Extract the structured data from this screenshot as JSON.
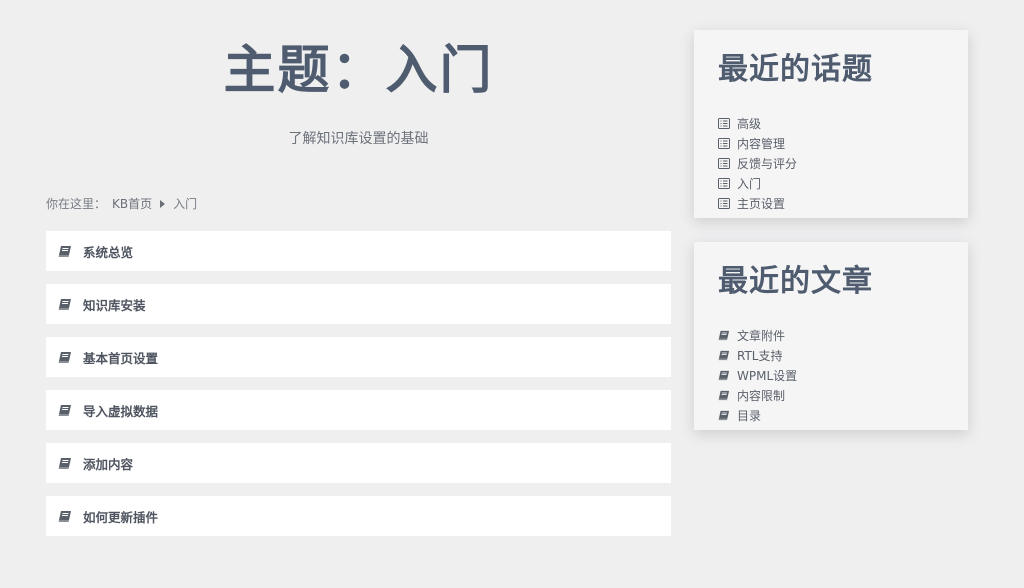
{
  "page": {
    "title": "主题：入门",
    "subtitle": "了解知识库设置的基础"
  },
  "breadcrumb": {
    "prefix": "你在这里：",
    "home": "KB首页",
    "current": "入门"
  },
  "articles": [
    {
      "label": "系统总览"
    },
    {
      "label": "知识库安装"
    },
    {
      "label": "基本首页设置"
    },
    {
      "label": "导入虚拟数据"
    },
    {
      "label": "添加内容"
    },
    {
      "label": "如何更新插件"
    }
  ],
  "recent_topics": {
    "title": "最近的话题",
    "items": [
      {
        "label": "高级",
        "icon": "list-icon"
      },
      {
        "label": "内容管理",
        "icon": "list-icon"
      },
      {
        "label": "反馈与评分",
        "icon": "list-icon"
      },
      {
        "label": "入门",
        "icon": "list-icon"
      },
      {
        "label": "主页设置",
        "icon": "list-icon"
      }
    ]
  },
  "recent_articles": {
    "title": "最近的文章",
    "items": [
      {
        "label": "文章附件",
        "icon": "book-icon"
      },
      {
        "label": "RTL支持",
        "icon": "book-icon"
      },
      {
        "label": "WPML设置",
        "icon": "book-icon"
      },
      {
        "label": "内容限制",
        "icon": "book-icon"
      },
      {
        "label": "目录",
        "icon": "book-icon"
      }
    ]
  },
  "colors": {
    "background": "#efeff0",
    "heading": "#4f5b6e",
    "card": "#ffffff",
    "icon": "#5a606a"
  }
}
